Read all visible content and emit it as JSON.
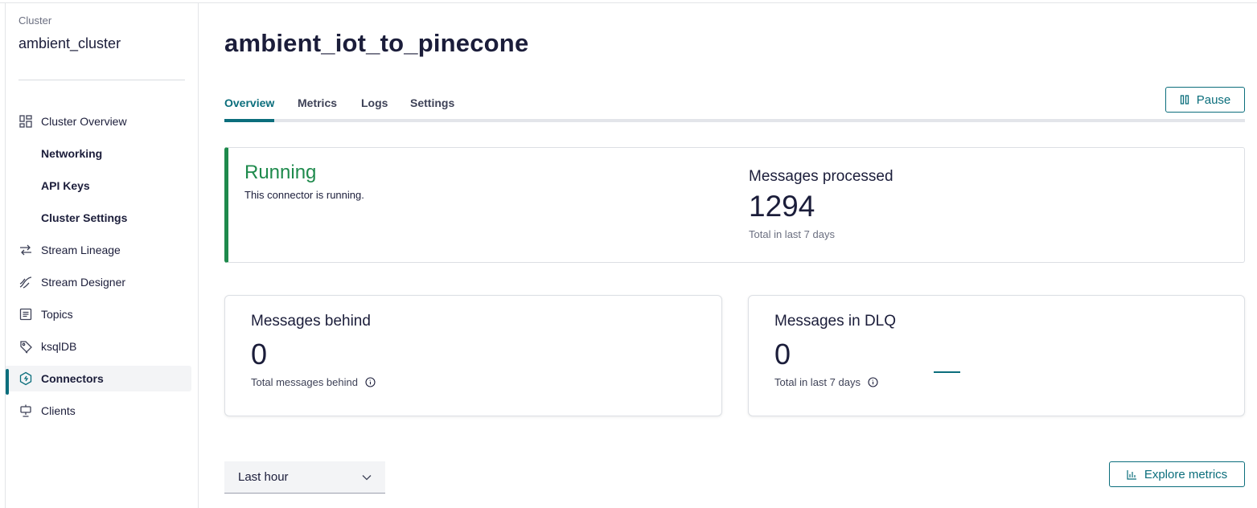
{
  "sidebar": {
    "cluster_caption": "Cluster",
    "cluster_name": "ambient_cluster",
    "items": [
      {
        "label": "Cluster Overview",
        "icon": "dashboard-icon"
      },
      {
        "label": "Networking"
      },
      {
        "label": "API Keys"
      },
      {
        "label": "Cluster Settings"
      },
      {
        "label": "Stream Lineage",
        "icon": "stream-lineage-icon"
      },
      {
        "label": "Stream Designer",
        "icon": "stream-designer-icon"
      },
      {
        "label": "Topics",
        "icon": "topics-icon"
      },
      {
        "label": "ksqlDB",
        "icon": "ksqldb-icon"
      },
      {
        "label": "Connectors",
        "icon": "connectors-icon",
        "active": true
      },
      {
        "label": "Clients",
        "icon": "clients-icon"
      }
    ]
  },
  "page": {
    "title": "ambient_iot_to_pinecone"
  },
  "tabs": [
    {
      "label": "Overview",
      "active": true
    },
    {
      "label": "Metrics"
    },
    {
      "label": "Logs"
    },
    {
      "label": "Settings"
    }
  ],
  "pause_button": {
    "label": "Pause",
    "icon": "pause-icon"
  },
  "status": {
    "title": "Running",
    "description": "This connector is running.",
    "messages_processed_label": "Messages processed",
    "messages_processed_value": "1294",
    "messages_processed_sub": "Total in last 7 days"
  },
  "messages_behind": {
    "title": "Messages behind",
    "value": "0",
    "sub": "Total messages behind"
  },
  "messages_dlq": {
    "title": "Messages in DLQ",
    "value": "0",
    "sub": "Total in last 7 days"
  },
  "time_range": {
    "selected": "Last hour"
  },
  "explore_button": {
    "label": "Explore metrics",
    "icon": "bar-chart-icon"
  },
  "colors": {
    "accent": "#0b6e7c",
    "running": "#1e8a4c",
    "text": "#1b1d3a"
  }
}
